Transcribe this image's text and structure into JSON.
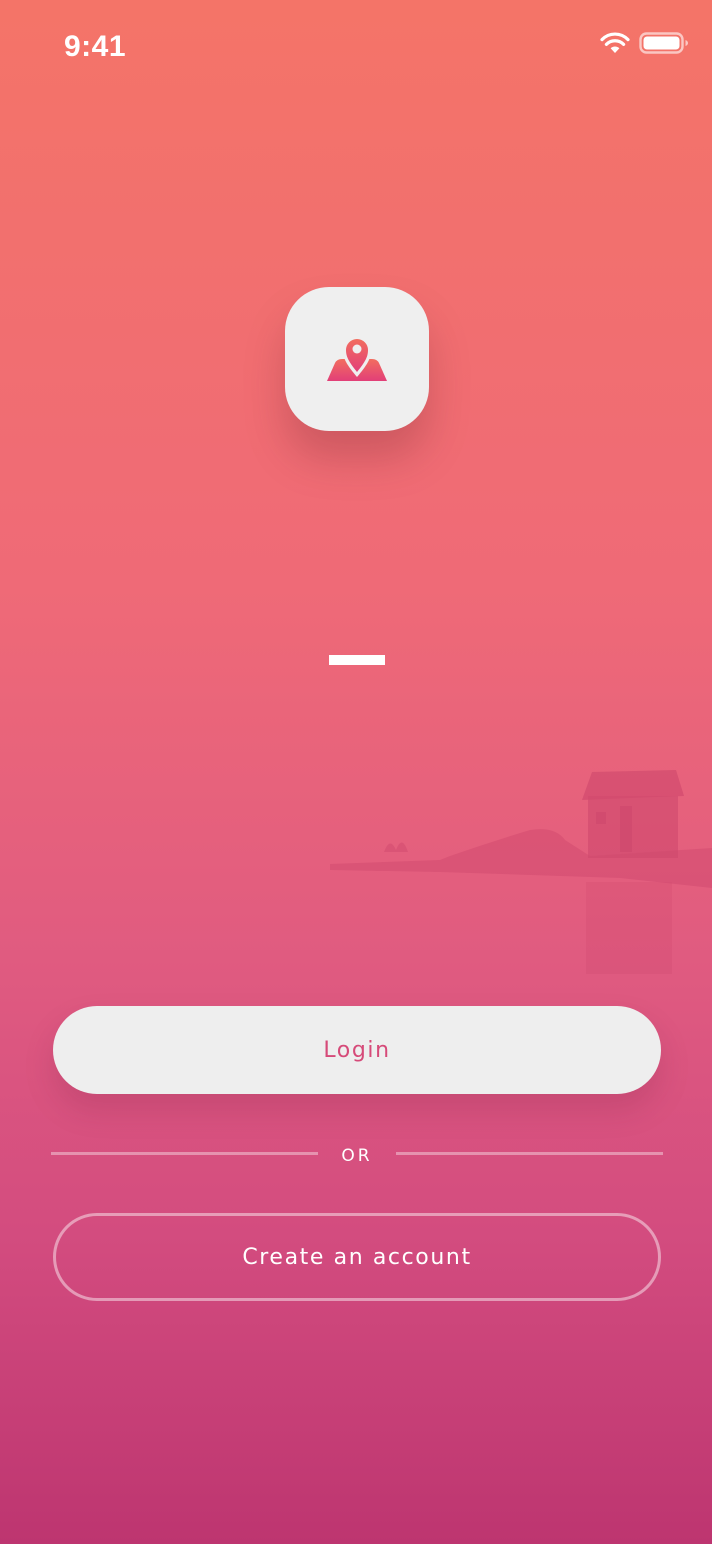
{
  "status_bar": {
    "time": "9:41",
    "wifi_icon": "wifi-icon",
    "battery_icon": "battery-icon"
  },
  "app_icon": {
    "icon": "map-pin-icon",
    "icon_colors": [
      "#f26d5f",
      "#e23f78"
    ],
    "background": "#efefef"
  },
  "actions": {
    "login_label": "Login",
    "or_label": "OR",
    "create_account_label": "Create an account"
  },
  "colors": {
    "gradient_top": "#f47468",
    "gradient_bottom": "#bd3570",
    "button_text": "#d64a79"
  }
}
